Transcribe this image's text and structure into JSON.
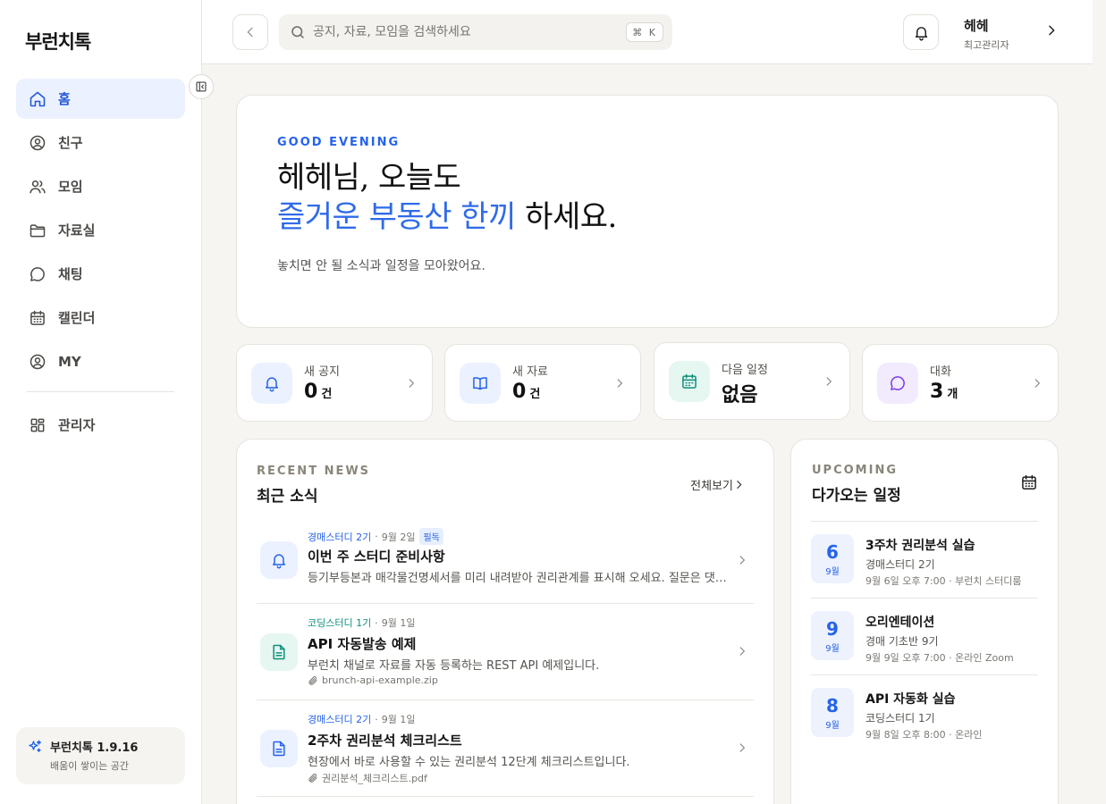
{
  "app": {
    "name": "부런치톡"
  },
  "sidebar": {
    "items": [
      {
        "label": "홈",
        "icon": "home-icon",
        "active": true
      },
      {
        "label": "친구",
        "icon": "user-circle-icon"
      },
      {
        "label": "모임",
        "icon": "users-icon"
      },
      {
        "label": "자료실",
        "icon": "folder-icon"
      },
      {
        "label": "채팅",
        "icon": "chat-icon"
      },
      {
        "label": "캘린더",
        "icon": "calendar-icon"
      },
      {
        "label": "MY",
        "icon": "user-circle-icon"
      }
    ],
    "admin": {
      "label": "관리자",
      "icon": "grid-icon"
    },
    "version": {
      "title": "부런치톡 1.9.16",
      "subtitle": "배움이 쌓이는 공간"
    }
  },
  "topbar": {
    "search_placeholder": "공지, 자료, 모임을 검색하세요",
    "shortcut": "⌘ K",
    "user": {
      "name": "헤헤",
      "role": "최고관리자"
    }
  },
  "hero": {
    "eyebrow": "GOOD EVENING",
    "line1": "헤헤님, 오늘도",
    "line2_highlight": "즐거운 부동산 한끼",
    "line2_rest": " 하세요.",
    "subtitle": "놓치면 안 될 소식과 일정을 모아왔어요."
  },
  "stats": [
    {
      "label": "새 공지",
      "value": "0",
      "unit": "건",
      "icon": "bell-icon",
      "color": "#2563eb",
      "bg": "#ebf1fe"
    },
    {
      "label": "새 자료",
      "value": "0",
      "unit": "건",
      "icon": "book-icon",
      "color": "#2563eb",
      "bg": "#ebf1fe"
    },
    {
      "label": "다음 일정",
      "value": "없음",
      "unit": "",
      "icon": "calendar-icon",
      "color": "#0f8f7a",
      "bg": "#e6f6f1"
    },
    {
      "label": "대화",
      "value": "3",
      "unit": "개",
      "icon": "chat-icon",
      "color": "#7c3aed",
      "bg": "#f1ebfd"
    }
  ],
  "news": {
    "eyebrow": "RECENT NEWS",
    "title": "최근 소식",
    "see_all": "전체보기",
    "items": [
      {
        "source": "경매스터디 2기",
        "date": "9월 2일",
        "badge": "필독",
        "title": "이번 주 스터디 준비사항",
        "desc": "등기부등본과 매각물건명세서를 미리 내려받아 권리관계를 표시해 오세요. 질문은 댓글로 남겨주세요.",
        "attachment": "",
        "icon": "bell-icon"
      },
      {
        "source": "코딩스터디 1기",
        "date": "9월 1일",
        "badge": "",
        "title": "API 자동발송 예제",
        "desc": "부런치 채널로 자료를 자동 등록하는 REST API 예제입니다.",
        "attachment": "brunch-api-example.zip",
        "icon": "document-icon"
      },
      {
        "source": "경매스터디 2기",
        "date": "9월 1일",
        "badge": "",
        "title": "2주차 권리분석 체크리스트",
        "desc": "현장에서 바로 사용할 수 있는 권리분석 12단계 체크리스트입니다.",
        "attachment": "권리분석_체크리스트.pdf",
        "icon": "document-icon"
      }
    ]
  },
  "upcoming": {
    "eyebrow": "UPCOMING",
    "title": "다가오는 일정",
    "events": [
      {
        "day": "6",
        "month": "9월",
        "title": "3주차 권리분석 실습",
        "group": "경매스터디 2기",
        "info": "9월 6일 오후 7:00 · 부런치 스터디룸"
      },
      {
        "day": "9",
        "month": "9월",
        "title": "오리엔테이션",
        "group": "경매 기초반 9기",
        "info": "9월 9일 오후 7:00 · 온라인 Zoom"
      },
      {
        "day": "8",
        "month": "9월",
        "title": "API 자동화 실습",
        "group": "코딩스터디 1기",
        "info": "9월 8일 오후 8:00 · 온라인"
      }
    ]
  }
}
